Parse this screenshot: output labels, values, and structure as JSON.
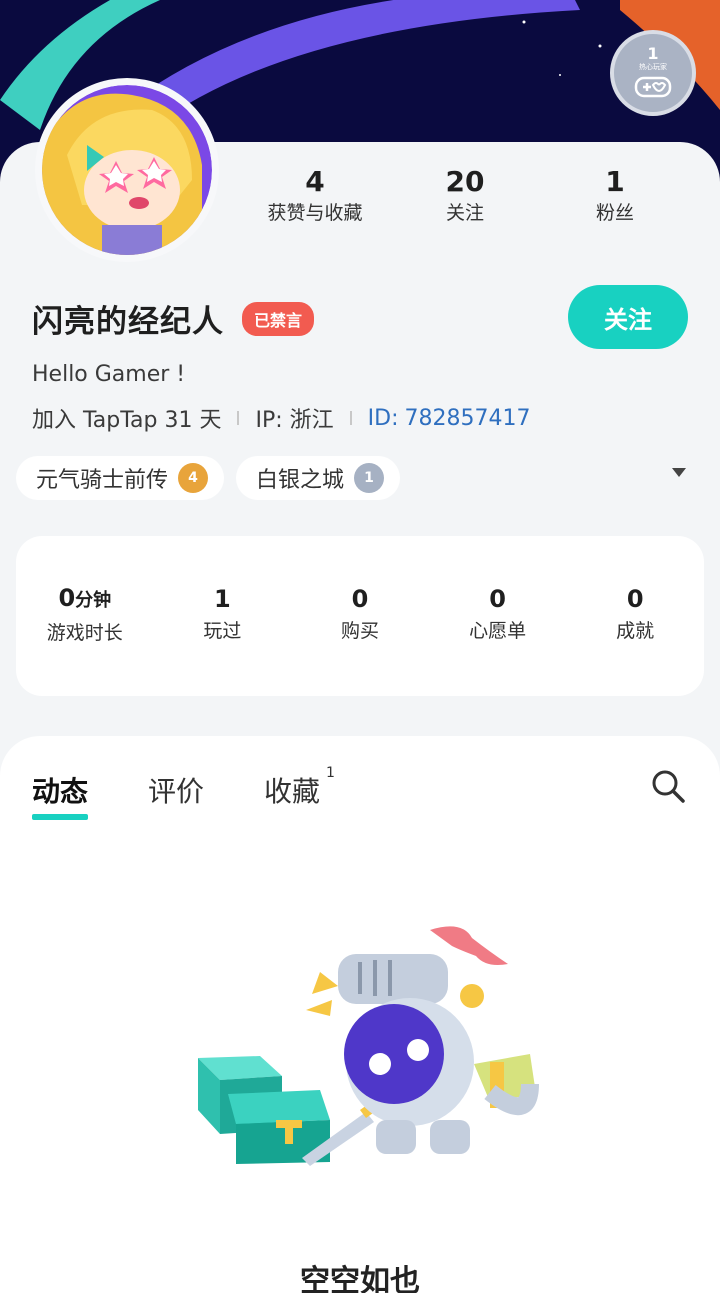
{
  "header": {
    "medal_count": "1",
    "medal_label": "热心玩家"
  },
  "profile": {
    "username": "闪亮的经纪人",
    "mute_badge": "已禁言",
    "follow_label": "关注",
    "bio": "Hello Gamer !",
    "join_text": "加入 TapTap 31 天",
    "ip_text": "IP:  浙江",
    "id_label": "ID:",
    "id_value": "782857417",
    "stats": [
      {
        "value": "4",
        "label": "获赞与收藏"
      },
      {
        "value": "20",
        "label": "关注"
      },
      {
        "value": "1",
        "label": "粉丝"
      }
    ],
    "game_tags": [
      {
        "name": "元气骑士前传",
        "level": "4"
      },
      {
        "name": "白银之城",
        "level": "1"
      }
    ]
  },
  "summary": [
    {
      "value": "0",
      "unit": "分钟",
      "label": "游戏时长"
    },
    {
      "value": "1",
      "unit": "",
      "label": "玩过"
    },
    {
      "value": "0",
      "unit": "",
      "label": "购买"
    },
    {
      "value": "0",
      "unit": "",
      "label": "心愿单"
    },
    {
      "value": "0",
      "unit": "",
      "label": "成就"
    }
  ],
  "feed": {
    "tabs": [
      {
        "label": "动态",
        "count": ""
      },
      {
        "label": "评价",
        "count": ""
      },
      {
        "label": "收藏",
        "count": "1"
      }
    ],
    "empty_text": "空空如也"
  },
  "colors": {
    "accent": "#18d1c1",
    "mute": "#f25b50",
    "header_bg": "#0a0a3f"
  },
  "icons": [
    "search-icon",
    "game-controller-icon",
    "expand-arrow-icon"
  ]
}
